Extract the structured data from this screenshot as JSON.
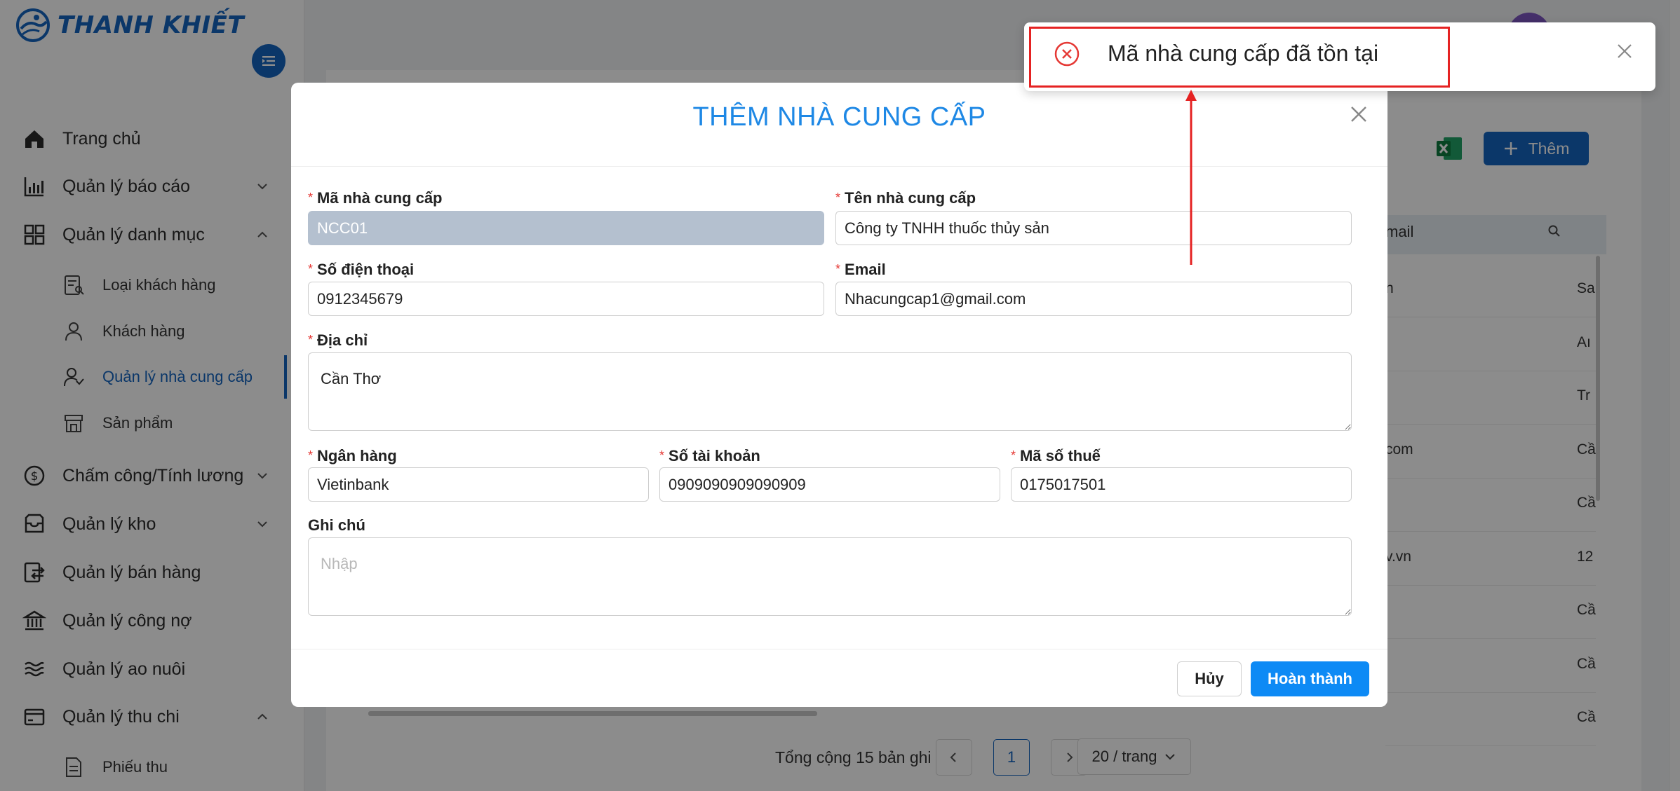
{
  "brand": {
    "name": "THANH KHIẾT"
  },
  "sidebar": {
    "items": [
      {
        "label": "Trang chủ",
        "icon": "home-icon"
      },
      {
        "label": "Quản lý báo cáo",
        "icon": "bar-chart-icon",
        "chevron": "down"
      },
      {
        "label": "Quản lý danh mục",
        "icon": "grid-icon",
        "chevron": "up"
      },
      {
        "label": "Chấm công/Tính lương",
        "icon": "dollar-circle-icon",
        "chevron": "down"
      },
      {
        "label": "Quản lý kho",
        "icon": "inbox-icon",
        "chevron": "down"
      },
      {
        "label": "Quản lý bán hàng",
        "icon": "transfer-icon"
      },
      {
        "label": "Quản lý công nợ",
        "icon": "bank-icon"
      },
      {
        "label": "Quản lý ao nuôi",
        "icon": "waves-icon"
      },
      {
        "label": "Quản lý thu chi",
        "icon": "wallet-icon",
        "chevron": "up"
      }
    ],
    "sub_catalog": [
      {
        "label": "Loại khách hàng",
        "icon": "user-list-icon"
      },
      {
        "label": "Khách hàng",
        "icon": "user-icon"
      },
      {
        "label": "Quản lý nhà cung cấp",
        "icon": "supplier-icon",
        "active": true
      },
      {
        "label": "Sản phẩm",
        "icon": "store-icon"
      }
    ],
    "sub_finance": [
      {
        "label": "Phiếu thu",
        "icon": "receipt-icon"
      }
    ]
  },
  "background": {
    "add_button": "Thêm",
    "table_header_email": "mail",
    "rows": [
      {
        "email": "n",
        "next": "Sa"
      },
      {
        "email": "",
        "next": "Aı"
      },
      {
        "email": "",
        "next": "Tr"
      },
      {
        "email": "com",
        "next": "Cầ"
      },
      {
        "email": "",
        "next": "Cầ"
      },
      {
        "email": "v.vn",
        "next": "12"
      },
      {
        "email": "",
        "next": "Cầ"
      },
      {
        "email": "",
        "next": "Cầ"
      },
      {
        "email": "",
        "next": "Cầ"
      }
    ],
    "pagination": {
      "total": "Tổng cộng 15 bản ghi",
      "page": "1",
      "page_size": "20 / trang"
    }
  },
  "modal": {
    "title": "THÊM NHÀ CUNG CẤP",
    "fields": {
      "supplier_code": {
        "label": "Mã nhà cung cấp",
        "value": "NCC01"
      },
      "supplier_name": {
        "label": "Tên nhà cung cấp",
        "value": "Công ty TNHH thuốc thủy sản"
      },
      "phone": {
        "label": "Số điện thoại",
        "value": "0912345679"
      },
      "email": {
        "label": "Email",
        "value": "Nhacungcap1@gmail.com"
      },
      "address": {
        "label": "Địa chỉ",
        "value": "Cần Thơ"
      },
      "bank": {
        "label": "Ngân hàng",
        "value": "Vietinbank"
      },
      "account_no": {
        "label": "Số tài khoản",
        "value": "0909090909090909"
      },
      "tax_code": {
        "label": "Mã số thuế",
        "value": "0175017501"
      },
      "note": {
        "label": "Ghi chú",
        "placeholder": "Nhập"
      }
    },
    "required_mark": "*",
    "buttons": {
      "cancel": "Hủy",
      "submit": "Hoàn thành"
    }
  },
  "toast": {
    "message": "Mã nhà cung cấp đã tồn tại",
    "type": "error"
  },
  "colors": {
    "primary": "#1565c0",
    "accent": "#0d8af5",
    "title": "#1e88e5",
    "error": "#e53935",
    "annotation": "#e52222"
  }
}
